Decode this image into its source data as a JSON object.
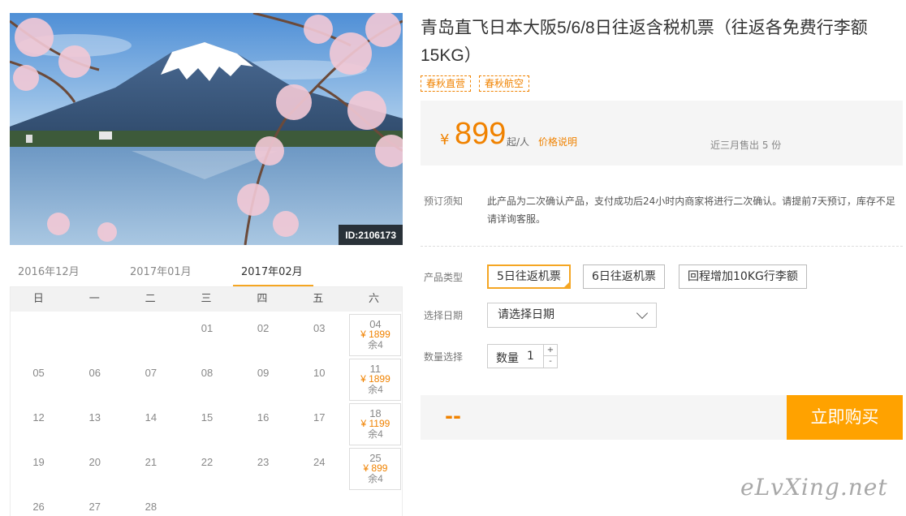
{
  "product": {
    "photo_id": "ID:2106173",
    "title": "青岛直飞日本大阪5/6/8日往返含税机票（往返各免费行李额15KG）",
    "tags": [
      "春秋直营",
      "春秋航空"
    ]
  },
  "price": {
    "currency": "¥",
    "amount": "899",
    "unit": "起/人",
    "note_link": "价格说明",
    "sold": "近三月售出 5 份"
  },
  "notice": {
    "label": "预订须知",
    "text": "此产品为二次确认产品，支付成功后24小时内商家将进行二次确认。请提前7天预订，库存不足请详询客服。"
  },
  "options": {
    "type_label": "产品类型",
    "types": [
      "5日往返机票",
      "6日往返机票",
      "回程增加10KG行李额"
    ],
    "selected_type": 0,
    "date_label": "选择日期",
    "date_value": "请选择日期",
    "qty_label": "数量选择",
    "qty_prefix": "数量",
    "qty_value": "1",
    "qty_up": "+",
    "qty_down": "-"
  },
  "buy": {
    "total": "--",
    "button": "立即购买"
  },
  "calendar": {
    "months": [
      "2016年12月",
      "2017年01月",
      "2017年02月"
    ],
    "active_month": 2,
    "weekdays": [
      "日",
      "一",
      "二",
      "三",
      "四",
      "五",
      "六"
    ],
    "cells": [
      {
        "day": "01",
        "row": 0,
        "col": 3
      },
      {
        "day": "02",
        "row": 0,
        "col": 4
      },
      {
        "day": "03",
        "row": 0,
        "col": 5
      },
      {
        "day": "04",
        "row": 0,
        "col": 6,
        "price": "¥ 1899",
        "stock": "余4"
      },
      {
        "day": "05",
        "row": 1,
        "col": 0
      },
      {
        "day": "06",
        "row": 1,
        "col": 1
      },
      {
        "day": "07",
        "row": 1,
        "col": 2
      },
      {
        "day": "08",
        "row": 1,
        "col": 3
      },
      {
        "day": "09",
        "row": 1,
        "col": 4
      },
      {
        "day": "10",
        "row": 1,
        "col": 5
      },
      {
        "day": "11",
        "row": 1,
        "col": 6,
        "price": "¥ 1899",
        "stock": "余4"
      },
      {
        "day": "12",
        "row": 2,
        "col": 0
      },
      {
        "day": "13",
        "row": 2,
        "col": 1
      },
      {
        "day": "14",
        "row": 2,
        "col": 2
      },
      {
        "day": "15",
        "row": 2,
        "col": 3
      },
      {
        "day": "16",
        "row": 2,
        "col": 4
      },
      {
        "day": "17",
        "row": 2,
        "col": 5
      },
      {
        "day": "18",
        "row": 2,
        "col": 6,
        "price": "¥ 1199",
        "stock": "余4"
      },
      {
        "day": "19",
        "row": 3,
        "col": 0
      },
      {
        "day": "20",
        "row": 3,
        "col": 1
      },
      {
        "day": "21",
        "row": 3,
        "col": 2
      },
      {
        "day": "22",
        "row": 3,
        "col": 3
      },
      {
        "day": "23",
        "row": 3,
        "col": 4
      },
      {
        "day": "24",
        "row": 3,
        "col": 5
      },
      {
        "day": "25",
        "row": 3,
        "col": 6,
        "price": "¥ 899",
        "stock": "余4"
      },
      {
        "day": "26",
        "row": 4,
        "col": 0
      },
      {
        "day": "27",
        "row": 4,
        "col": 1
      },
      {
        "day": "28",
        "row": 4,
        "col": 2
      }
    ]
  },
  "watermark": "eLvXing.net",
  "colors": {
    "accent": "#f08200",
    "button": "#ffa200",
    "tab_underline": "#f5a623"
  }
}
